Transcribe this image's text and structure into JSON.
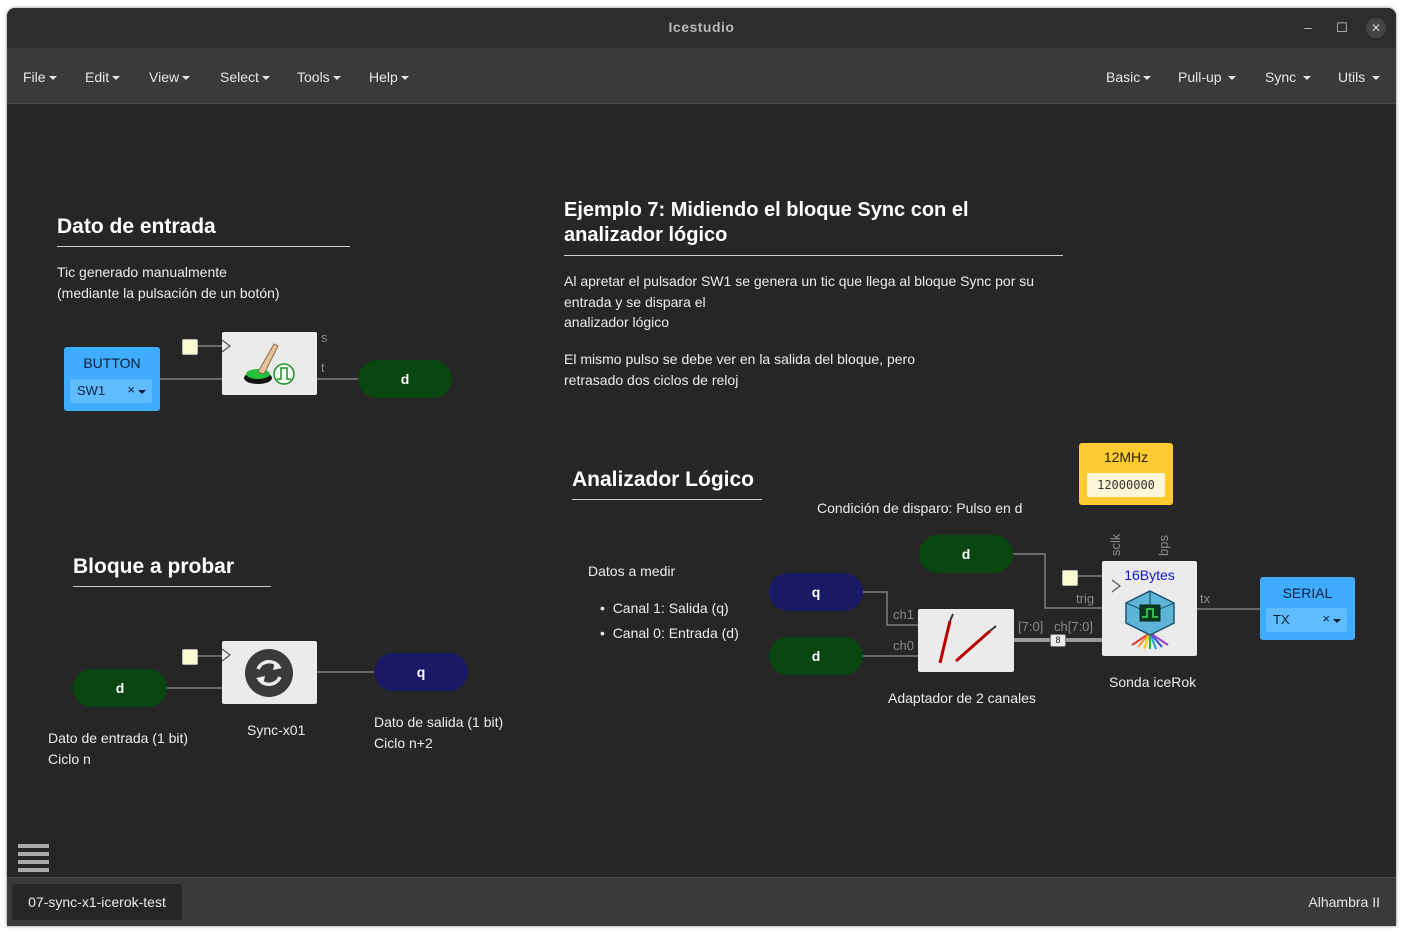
{
  "window": {
    "title": "Icestudio"
  },
  "menus_left": [
    {
      "label": "File"
    },
    {
      "label": "Edit"
    },
    {
      "label": "View"
    },
    {
      "label": "Select"
    },
    {
      "label": "Tools"
    },
    {
      "label": "Help"
    }
  ],
  "menus_right": [
    {
      "label": "Basic"
    },
    {
      "label": "Pull-up"
    },
    {
      "label": "Sync"
    },
    {
      "label": "Utils"
    }
  ],
  "sections": {
    "input": {
      "heading": "Dato de entrada",
      "desc1": "Tic generado manualmente",
      "desc2": "(mediante la pulsación de un botón)"
    },
    "example": {
      "heading1": "Ejemplo 7: Midiendo el bloque Sync con el",
      "heading2": "analizador lógico",
      "p1_l1": "Al apretar el pulsador SW1 se genera un tic que llega al bloque Sync por su",
      "p1_l2": "entrada y se dispara el",
      "p1_l3": "analizador lógico",
      "p2_l1": "El mismo pulso se debe ver en la salida del bloque, pero",
      "p2_l2": "retrasado dos ciclos de reloj"
    },
    "test": {
      "heading": "Bloque a probar"
    },
    "analyzer": {
      "heading": "Analizador Lógico",
      "trigger": "Condición de disparo: Pulso en d",
      "measure": "Datos a medir",
      "ch1": "Canal 1: Salida (q)",
      "ch0": "Canal 0: Entrada (d)"
    }
  },
  "blocks": {
    "button": {
      "label": "BUTTON",
      "value": "SW1"
    },
    "toggle": {
      "port_s": "s",
      "port_t": "t"
    },
    "out_d": {
      "label": "d"
    },
    "in_d": {
      "label": "d"
    },
    "in_d_caption1": "Dato de entrada (1 bit)",
    "in_d_caption2": "Ciclo n",
    "sync": {
      "caption": "Sync-x01"
    },
    "out_q": {
      "label": "q"
    },
    "out_q_caption1": "Dato de salida (1 bit)",
    "out_q_caption2": "Ciclo n+2",
    "clk_const": {
      "label": "12MHz",
      "value": "12000000"
    },
    "la_d": {
      "label": "d"
    },
    "la_q": {
      "label": "q"
    },
    "la_d2": {
      "label": "d"
    },
    "adapter": {
      "caption": "Adaptador de 2 canales",
      "port_ch1": "ch1",
      "port_ch0": "ch0",
      "port_out": "[7:0]",
      "bus_width": "8"
    },
    "probe": {
      "title": "16Bytes",
      "caption": "Sonda iceRok",
      "port_sclk": "sclk",
      "port_bps": "bps",
      "port_trig": "trig",
      "port_ch": "ch[7:0]",
      "port_tx": "tx"
    },
    "serial": {
      "label": "SERIAL",
      "value": "TX"
    }
  },
  "status": {
    "tab": "07-sync-x1-icerok-test",
    "board": "Alhambra II"
  },
  "colors": {
    "canvas": "#262626",
    "input_port": "#40acff",
    "wire_green": "#07470f",
    "wire_navy": "#1a1966",
    "constant": "#ffcb32"
  }
}
